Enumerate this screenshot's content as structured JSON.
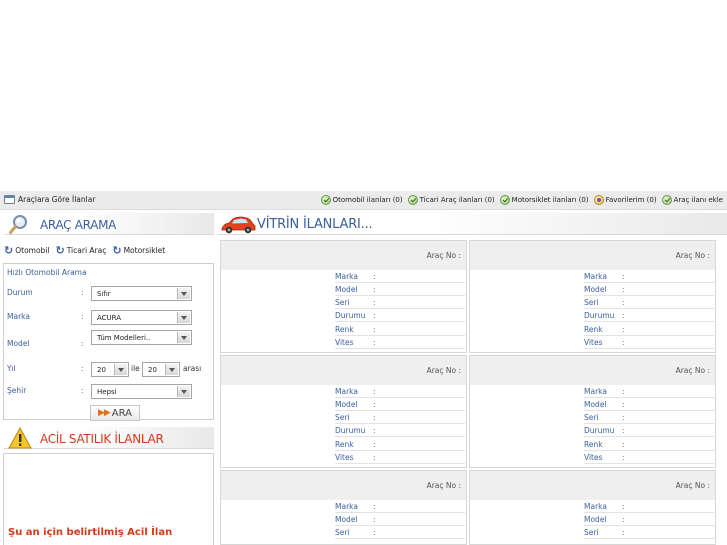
{
  "topbar": {
    "left_label": "Araçlara Göre İlanlar",
    "links": [
      {
        "label": "Otomobil ilanları (0)",
        "icon": "check-badge-icon"
      },
      {
        "label": "Ticari Araç ilanları (0)",
        "icon": "check-badge-icon"
      },
      {
        "label": "Motorsiklet ilanları (0)",
        "icon": "check-badge-icon"
      },
      {
        "label": "Favorilerim (0)",
        "icon": "favorites-icon"
      },
      {
        "label": "Araç ilanı ekle",
        "icon": "check-badge-icon"
      }
    ]
  },
  "arama": {
    "title": "ARAÇ ARAMA",
    "categories": [
      "Otomobil",
      "Ticari Araç",
      "Motorsiklet"
    ],
    "box_title": "Hızlı Otomobil Arama",
    "colon": ":",
    "durum": {
      "label": "Durum",
      "value": "Sıfır"
    },
    "marka": {
      "label": "Marka",
      "value": "ACURA"
    },
    "model": {
      "label": "Model",
      "value": "Tüm Modelleri.."
    },
    "yil": {
      "label": "Yıl",
      "from": "20",
      "between": "ile",
      "to": "20",
      "suffix": "arası"
    },
    "sehir": {
      "label": "Şehir",
      "value": "Hepsi"
    },
    "search_button": "ARA",
    "search_arrows": "▶▶"
  },
  "acil": {
    "title": "ACİL SATILIK İLANLAR",
    "message": "Şu an için belirtilmiş Acil İlan"
  },
  "vitrin": {
    "title": "VİTRİN İLANLARI...",
    "arac_no_label": "Araç No :",
    "field_labels": [
      "Marka",
      "Model",
      "Seri",
      "Durumu",
      "Renk",
      "Vites"
    ],
    "colon": ":"
  },
  "colors": {
    "link_blue": "#3a5f9f",
    "accent_red": "#d23a1a",
    "topbar_bg": "#ebebeb",
    "card_header_bg": "#efefef"
  }
}
